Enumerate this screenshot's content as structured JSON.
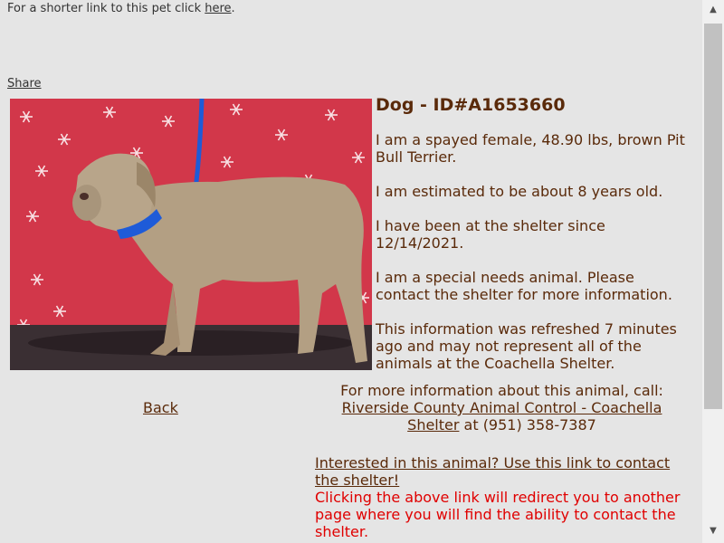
{
  "top_note": {
    "text": "For a shorter link to this pet click ",
    "link": "here",
    "suffix": "."
  },
  "share_label": "Share",
  "pet": {
    "title": "Dog - ID#A1653660",
    "paragraphs": [
      "I am a spayed female, 48.90 lbs, brown Pit Bull Terrier.",
      "I am estimated to be about 8 years old.",
      "I have been at the shelter since 12/14/2021.",
      "I am a special needs animal. Please contact the shelter for more information.",
      "This information was refreshed 7 minutes ago and may not represent all of the animals at the Coachella Shelter."
    ]
  },
  "back_label": "Back",
  "contact": {
    "intro": "For more information about this animal, call:",
    "shelter_link": "Riverside County Animal Control - Coachella Shelter",
    "phone": " at (951) 358-7387"
  },
  "interest": {
    "link": "Interested in this animal? Use this link to contact the shelter!",
    "redirect_note": "Clicking the above link will redirect you to another page where you will find the ability to contact the shelter."
  },
  "colors": {
    "text": "#5a2a0a",
    "warning": "#e00000",
    "background": "#e5e5e5"
  },
  "scrollbar": {
    "up_icon": "▲",
    "down_icon": "▼"
  }
}
